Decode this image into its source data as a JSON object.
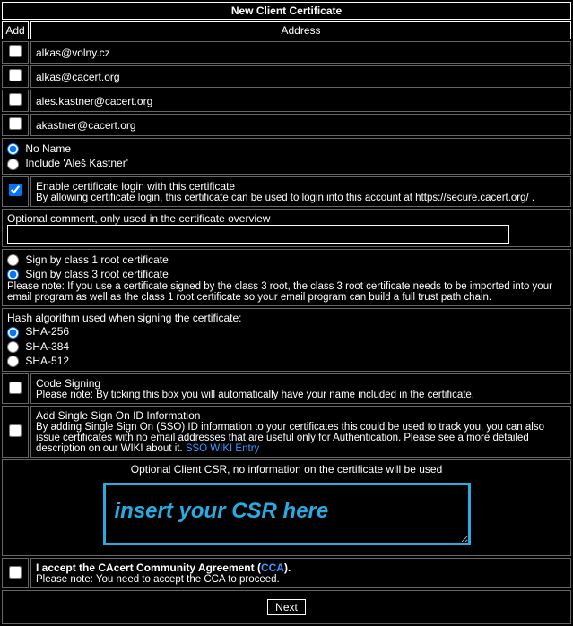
{
  "title": "New Client Certificate",
  "cols": {
    "add": "Add",
    "address": "Address"
  },
  "emails": [
    "alkas@volny.cz",
    "alkas@cacert.org",
    "ales.kastner@cacert.org",
    "akastner@cacert.org"
  ],
  "name_options": {
    "none": "No Name",
    "include": "Include 'Aleš Kastner'"
  },
  "enable_login": {
    "title": "Enable certificate login with this certificate",
    "desc": "By allowing certificate login, this certificate can be used to login into this account at https://secure.cacert.org/ ."
  },
  "comment_label": "Optional comment, only used in the certificate overview",
  "root_cert": {
    "class1": "Sign by class 1 root certificate",
    "class3": "Sign by class 3 root certificate",
    "note": "Please note: If you use a certificate signed by the class 3 root, the class 3 root certificate needs to be imported into your email program as well as the class 1 root certificate so your email program can build a full trust path chain."
  },
  "hash": {
    "label": "Hash algorithm used when signing the certificate:",
    "sha256": "SHA-256",
    "sha384": "SHA-384",
    "sha512": "SHA-512"
  },
  "code_signing": {
    "title": "Code Signing",
    "desc": "Please note: By ticking this box you will automatically have your name included in the certificate."
  },
  "sso": {
    "title": "Add Single Sign On ID Information",
    "desc": "By adding Single Sign On (SSO) ID information to your certificates this could be used to track you, you can also issue certificates with no email addresses that are useful only for Authentication. Please see a more detailed description on our WIKI about it. ",
    "link": "SSO WIKI Entry"
  },
  "csr": {
    "label": "Optional Client CSR, no information on the certificate will be used",
    "placeholder": "insert your CSR here"
  },
  "cca": {
    "prefix": "I accept the CAcert Community Agreement (",
    "link": "CCA",
    "suffix": ").",
    "note": "Please note: You need to accept the CCA to proceed."
  },
  "next": "Next"
}
